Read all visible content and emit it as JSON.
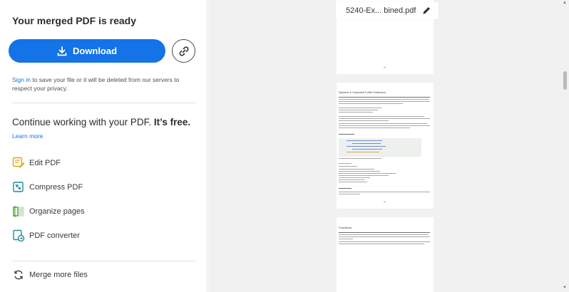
{
  "left": {
    "title": "Your merged PDF is ready",
    "download_label": "Download",
    "signin_link": "Sign in",
    "signin_text": " to save your file or it will be deleted from our servers to respect your privacy.",
    "continue_text": "Continue working with your PDF. ",
    "continue_bold": "It’s free.",
    "learn_more": "Learn more",
    "tools": [
      {
        "label": "Edit PDF",
        "icon": "edit-pdf-icon"
      },
      {
        "label": "Compress PDF",
        "icon": "compress-pdf-icon"
      },
      {
        "label": "Organize pages",
        "icon": "organize-pages-icon"
      },
      {
        "label": "PDF converter",
        "icon": "pdf-converter-icon"
      }
    ],
    "merge_more": "Merge more files"
  },
  "preview": {
    "file_name": "5240-Ex... bined.pdf",
    "page2_heading": "Question 4: Generated Coffee Generators",
    "page3_heading": "Conclusion"
  },
  "colors": {
    "accent": "#1473e6",
    "edit_icon": "#e8a200",
    "compress_icon": "#1d8c97",
    "organize_icon": "#3d9f28",
    "converter_icon": "#1d8c97"
  }
}
